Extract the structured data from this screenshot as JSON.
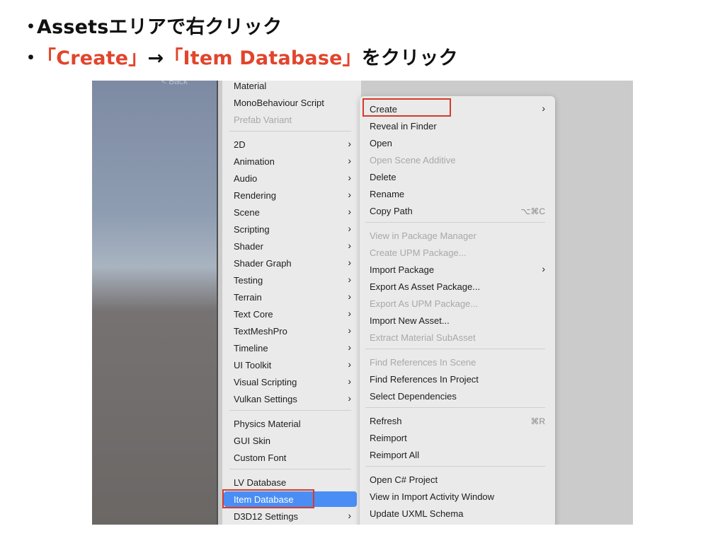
{
  "bullets": [
    {
      "mark": "・",
      "plain": "Assetsエリアで右クリック"
    },
    {
      "mark": "・",
      "red1": "「Create」",
      "arrow": "→",
      "red2": "「Item Database」",
      "tail": "をクリック"
    }
  ],
  "scene": {
    "back_label": "< Back"
  },
  "create_menu": {
    "items": [
      {
        "label": "Material"
      },
      {
        "label": "MonoBehaviour Script"
      },
      {
        "label": "Prefab Variant",
        "disabled": true
      },
      {
        "label": "2D",
        "submenu": true
      },
      {
        "label": "Animation",
        "submenu": true
      },
      {
        "label": "Audio",
        "submenu": true
      },
      {
        "label": "Rendering",
        "submenu": true
      },
      {
        "label": "Scene",
        "submenu": true
      },
      {
        "label": "Scripting",
        "submenu": true
      },
      {
        "label": "Shader",
        "submenu": true
      },
      {
        "label": "Shader Graph",
        "submenu": true
      },
      {
        "label": "Testing",
        "submenu": true
      },
      {
        "label": "Terrain",
        "submenu": true
      },
      {
        "label": "Text Core",
        "submenu": true
      },
      {
        "label": "TextMeshPro",
        "submenu": true
      },
      {
        "label": "Timeline",
        "submenu": true
      },
      {
        "label": "UI Toolkit",
        "submenu": true
      },
      {
        "label": "Visual Scripting",
        "submenu": true
      },
      {
        "label": "Vulkan Settings",
        "submenu": true
      },
      {
        "label": "Physics Material"
      },
      {
        "label": "GUI Skin"
      },
      {
        "label": "Custom Font"
      },
      {
        "label": "LV Database"
      },
      {
        "label": "Item Database",
        "selected": true
      },
      {
        "label": "D3D12 Settings",
        "submenu": true
      }
    ]
  },
  "context_menu": {
    "items": [
      {
        "label": "Create",
        "submenu": true,
        "highlighted": true
      },
      {
        "label": "Reveal in Finder"
      },
      {
        "label": "Open"
      },
      {
        "label": "Open Scene Additive",
        "disabled": true
      },
      {
        "label": "Delete"
      },
      {
        "label": "Rename"
      },
      {
        "label": "Copy Path",
        "shortcut": "⌥⌘C"
      },
      {
        "label": "View in Package Manager",
        "disabled": true
      },
      {
        "label": "Create UPM Package...",
        "disabled": true
      },
      {
        "label": "Import Package",
        "submenu": true
      },
      {
        "label": "Export As Asset Package..."
      },
      {
        "label": "Export As UPM Package...",
        "disabled": true
      },
      {
        "label": "Import New Asset..."
      },
      {
        "label": "Extract Material SubAsset",
        "disabled": true
      },
      {
        "label": "Find References In Scene",
        "disabled": true
      },
      {
        "label": "Find References In Project"
      },
      {
        "label": "Select Dependencies"
      },
      {
        "label": "Refresh",
        "shortcut": "⌘R"
      },
      {
        "label": "Reimport"
      },
      {
        "label": "Reimport All"
      },
      {
        "label": "Open C# Project"
      },
      {
        "label": "View in Import Activity Window"
      },
      {
        "label": "Update UXML Schema"
      }
    ]
  },
  "colors": {
    "accent_red": "#e1452c",
    "selection_blue": "#4a8ef5",
    "highlight_box": "#d43b2a"
  }
}
